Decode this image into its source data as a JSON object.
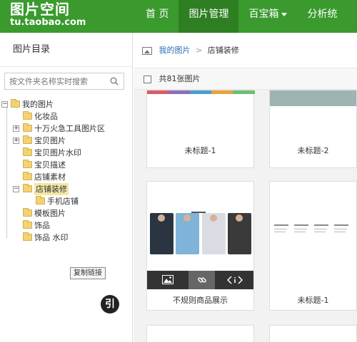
{
  "header": {
    "logo_main": "图片空间",
    "logo_sub": "tu.taobao.com",
    "nav": [
      "首 页",
      "图片管理",
      "百宝箱",
      "分析统"
    ],
    "active_index": 1
  },
  "sidebar": {
    "title": "图片目录",
    "search_placeholder": "按文件夹名称实时搜索",
    "tree": [
      {
        "label": "我的图片",
        "level": 0,
        "toggle": "−"
      },
      {
        "label": "化妆品",
        "level": 1
      },
      {
        "label": "十万火急工具图片区",
        "level": 1,
        "toggle": "+"
      },
      {
        "label": "宝贝图片",
        "level": 1,
        "toggle": "+"
      },
      {
        "label": "宝贝图片水印",
        "level": 1
      },
      {
        "label": "宝贝描述",
        "level": 1
      },
      {
        "label": "店铺素材",
        "level": 1
      },
      {
        "label": "店铺装修",
        "level": 1,
        "toggle": "−",
        "selected": true
      },
      {
        "label": "手机店铺",
        "level": 2
      },
      {
        "label": "模板图片",
        "level": 1
      },
      {
        "label": "饰品",
        "level": 1
      },
      {
        "label": "饰品 水印",
        "level": 1
      }
    ]
  },
  "main": {
    "breadcrumb": {
      "root": "我的图片",
      "separator": ">",
      "current": "店铺装修"
    },
    "count_label": "共81张图片",
    "cards": [
      {
        "title": "未标题-1"
      },
      {
        "title": "未标题-2"
      },
      {
        "title": "不规则商品展示",
        "hovered": true
      },
      {
        "title": "未标题-1"
      }
    ],
    "tooltip": "复制链接",
    "badge": "引",
    "colors": {
      "header": "#3a9a2e",
      "nav_active": "#2d7f22",
      "link": "#2a6fb5"
    }
  }
}
